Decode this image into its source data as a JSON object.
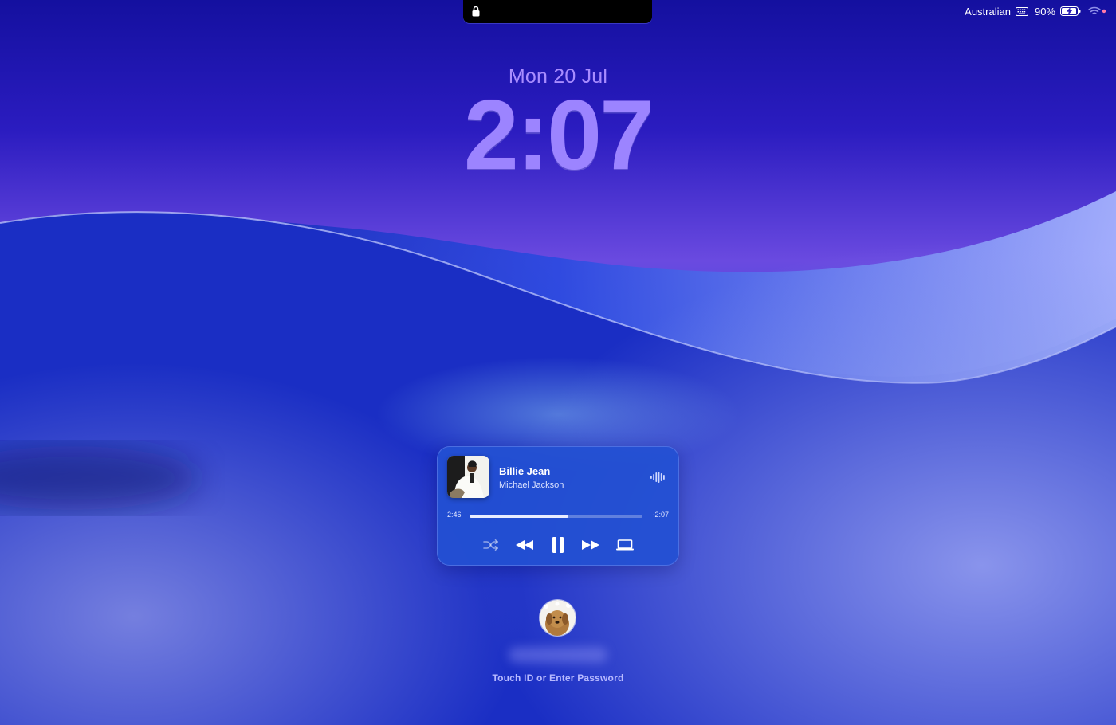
{
  "menubar": {
    "input_source": "Australian",
    "keyboard_icon": "keyboard-icon",
    "battery_percent": "90%",
    "battery_icon": "battery-charging-icon",
    "wifi_icon": "wifi-icon"
  },
  "lock_screen": {
    "date": "Mon 20 Jul",
    "time": "2:07",
    "hint": "Touch ID or Enter Password"
  },
  "now_playing": {
    "title": "Billie Jean",
    "artist": "Michael Jackson",
    "elapsed": "2:46",
    "remaining": "-2:07",
    "progress": 0.57,
    "controls": [
      "shuffle-icon",
      "rewind-icon",
      "pause-icon",
      "fast-forward-icon",
      "laptop-output-icon"
    ]
  },
  "colors": {
    "wallpaper_top": "#1a11a8",
    "wallpaper_mid": "#6e4ee0",
    "accent_text": "#9c84ff",
    "player_bg": "#2350d2"
  }
}
